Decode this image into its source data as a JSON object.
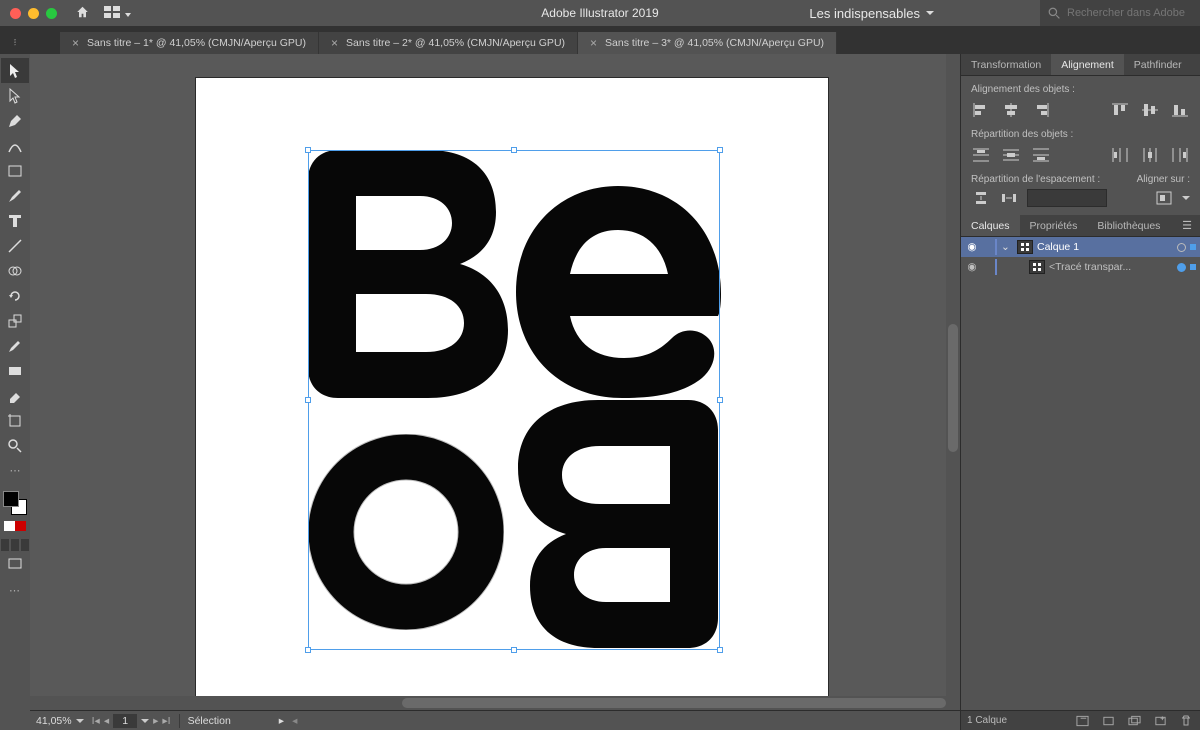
{
  "app": {
    "title": "Adobe Illustrator 2019"
  },
  "workspace": {
    "label": "Les indispensables"
  },
  "search": {
    "placeholder": "Rechercher dans Adobe Stock"
  },
  "tabs": [
    {
      "label": "Sans titre – 1* @ 41,05% (CMJN/Aperçu GPU)",
      "active": false
    },
    {
      "label": "Sans titre – 2* @ 41,05% (CMJN/Aperçu GPU)",
      "active": false
    },
    {
      "label": "Sans titre – 3* @ 41,05% (CMJN/Aperçu GPU)",
      "active": true
    }
  ],
  "align_panel": {
    "tabs": {
      "transformation": "Transformation",
      "alignement": "Alignement",
      "pathfinder": "Pathfinder"
    },
    "section_align": "Alignement des objets :",
    "section_dist": "Répartition des objets :",
    "section_space": "Répartition de l'espacement :",
    "align_to": "Aligner sur :"
  },
  "layers_panel": {
    "tabs": {
      "calques": "Calques",
      "props": "Propriétés",
      "libs": "Bibliothèques"
    },
    "rows": [
      {
        "name": "Calque 1",
        "selected": true,
        "expanded": true
      },
      {
        "name": "<Tracé transpar...",
        "selected": false
      }
    ],
    "footer": {
      "count": "1 Calque"
    }
  },
  "status": {
    "zoom": "41,05%",
    "page": "1",
    "tool": "Sélection"
  }
}
